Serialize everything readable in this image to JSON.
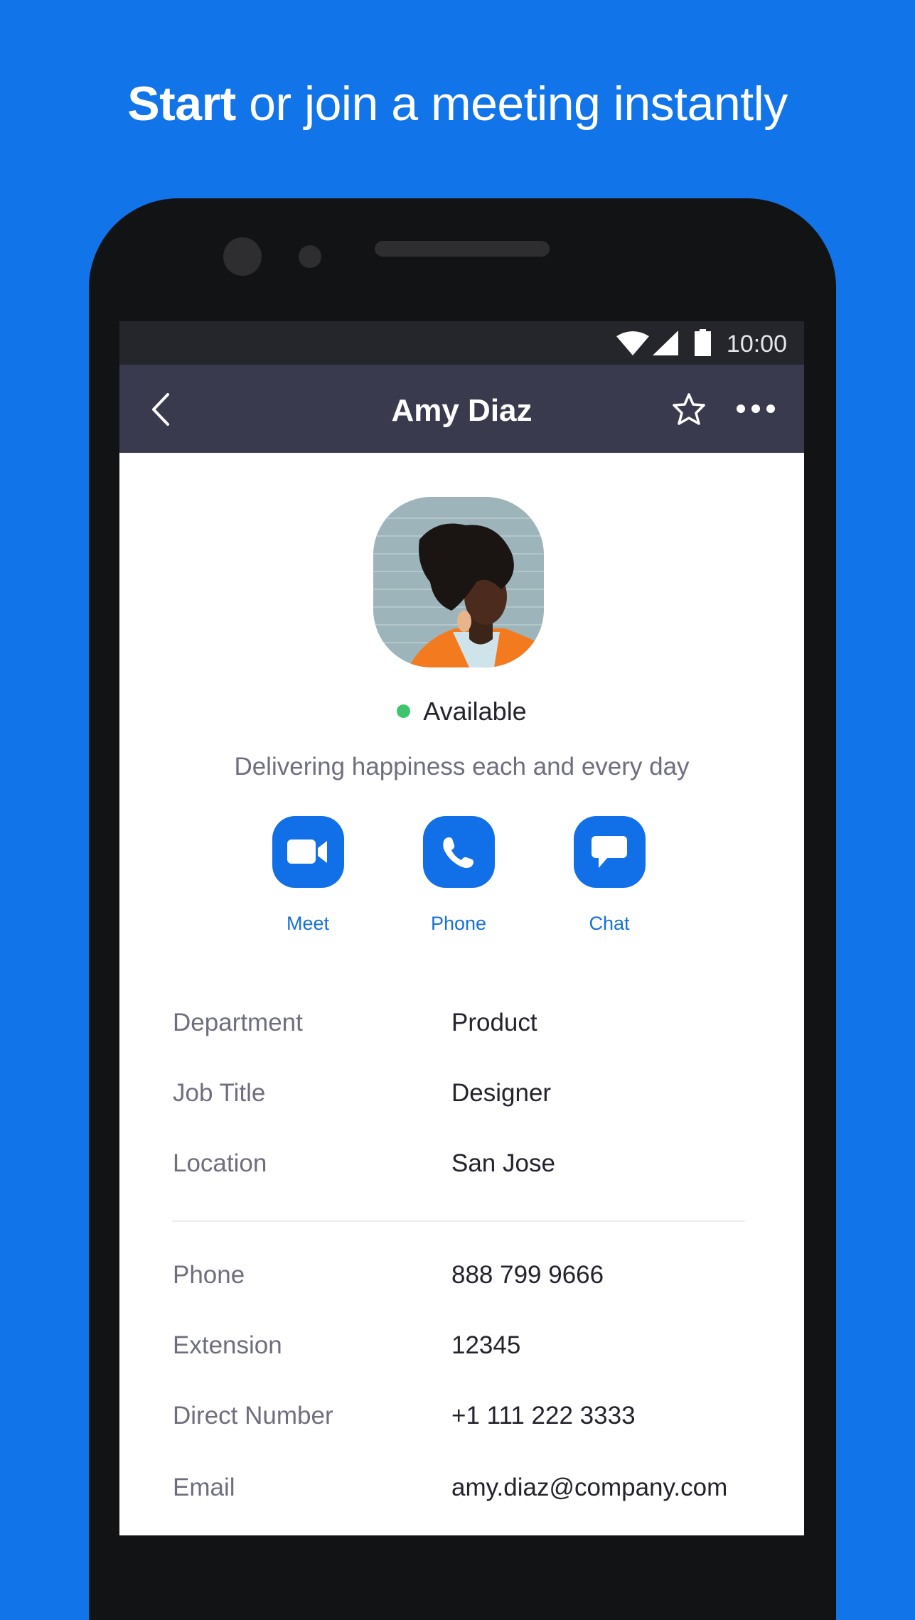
{
  "headline": {
    "bold": "Start",
    "rest": " or join a meeting instantly"
  },
  "status_bar": {
    "time": "10:00",
    "icons": [
      "wifi-icon",
      "cell-signal-icon",
      "battery-icon"
    ]
  },
  "app_bar": {
    "title": "Amy Diaz",
    "back_icon": "chevron-left-icon",
    "favorite_icon": "star-outline-icon",
    "more_icon": "more-horizontal-icon"
  },
  "profile": {
    "name": "Amy Diaz",
    "presence": "Available",
    "presence_color": "#3ec46d",
    "bio": "Delivering happiness each and every day"
  },
  "actions": [
    {
      "label": "Meet",
      "icon": "video-camera-icon"
    },
    {
      "label": "Phone",
      "icon": "phone-icon"
    },
    {
      "label": "Chat",
      "icon": "chat-bubble-icon"
    }
  ],
  "details_primary": [
    {
      "label": "Department",
      "value": "Product"
    },
    {
      "label": "Job Title",
      "value": "Designer"
    },
    {
      "label": "Location",
      "value": "San Jose"
    }
  ],
  "details_contact": [
    {
      "label": "Phone",
      "value": "888 799 9666"
    },
    {
      "label": "Extension",
      "value": "12345"
    },
    {
      "label": "Direct Number",
      "value": "+1 111 222 3333"
    },
    {
      "label": "Email",
      "value": "amy.diaz@company.com"
    }
  ],
  "colors": {
    "background": "#1174e9",
    "accent": "#1170e8",
    "app_bar": "#393a4d",
    "status_bar": "#25262c"
  }
}
